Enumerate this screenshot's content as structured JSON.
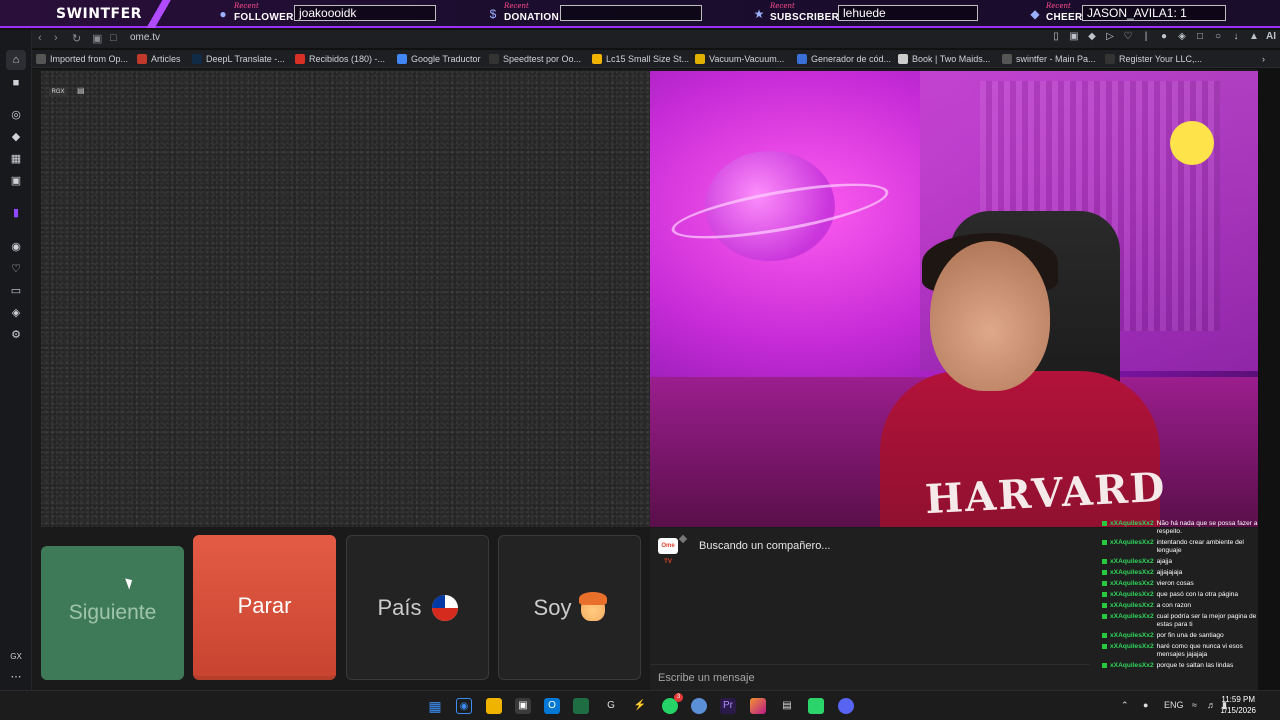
{
  "overlay": {
    "brand": "SWINTFER",
    "recent_word": "Recent",
    "follower": {
      "label": "FOLLOWER",
      "value": "joakoooidk"
    },
    "donation": {
      "label": "DONATION",
      "value": ""
    },
    "subscriber": {
      "label": "SUBSCRIBER",
      "value": "lehuede"
    },
    "cheer": {
      "label": "CHEER",
      "value": "JASON_AVILA1: 1"
    }
  },
  "browser": {
    "url": "ome.tv",
    "gx_label": "GX",
    "ai_label": "AI",
    "bookmarks": [
      "Imported from Op...",
      "Articles",
      "DeepL Translate -...",
      "Recibidos (180) -...",
      "Google Traductor",
      "Speedtest por Oo...",
      "Lc15 Small Size St...",
      "Vacuum-Vacuum...",
      "Generador de cód...",
      "Book | Two Maids...",
      "swintfer - Main Pa...",
      "Register Your LLC,..."
    ]
  },
  "page": {
    "rgx_label": "RGX",
    "buttons": {
      "next": "Siguiente",
      "stop": "Parar",
      "country": "País",
      "me": "Soy"
    },
    "chat": {
      "logo_text": "Ome TV",
      "status": "Buscando un compañero...",
      "input_placeholder": "Escribe un mensaje"
    },
    "webcam_shirt_text": "HARVARD",
    "stream_chat": [
      {
        "user": "xXAquilesXx2",
        "text": "Não há nada que se possa fazer a respeito."
      },
      {
        "user": "xXAquilesXx2",
        "text": "intentando crear ambiente del lenguaje"
      },
      {
        "user": "xXAquilesXx2",
        "text": "ajajja"
      },
      {
        "user": "xXAquilesXx2",
        "text": "ajjajajaja"
      },
      {
        "user": "xXAquilesXx2",
        "text": "vieron cosas"
      },
      {
        "user": "xXAquilesXx2",
        "text": "que pasó con la otra página"
      },
      {
        "user": "xXAquilesXx2",
        "text": "a con razon"
      },
      {
        "user": "xXAquilesXx2",
        "text": "cual podría ser la mejor pagina de estas para ti"
      },
      {
        "user": "xXAquilesXx2",
        "text": "por fin una de santiago"
      },
      {
        "user": "xXAquilesXx2",
        "text": "haré como que nunca vi esos mensajes jajajaja"
      },
      {
        "user": "xXAquilesXx2",
        "text": "porque te saltan las lindas"
      }
    ]
  },
  "taskbar": {
    "language": "ENG",
    "time": "11:59 PM",
    "date": "1/15/2026",
    "whatsapp_badge": "3"
  },
  "colors": {
    "accent_purple": "#9b2fff",
    "next_button": "#3f7a58",
    "stop_button": "#e35b44",
    "chat_username": "#2fd35a"
  }
}
